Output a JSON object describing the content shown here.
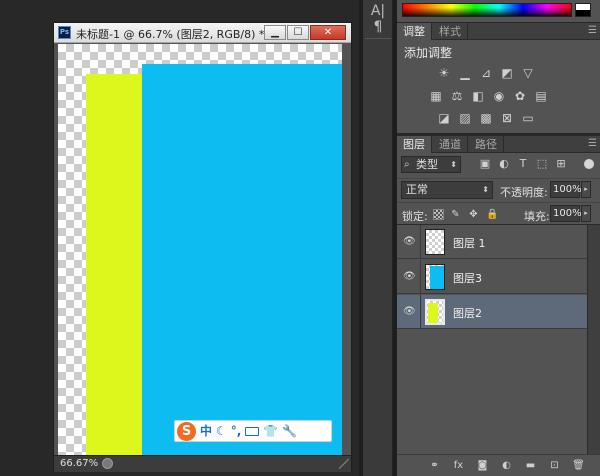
{
  "document": {
    "title": "未标题-1 @ 66.7% (图层2, RGB/8) *",
    "ps_badge": "Ps",
    "zoom": "66.67%",
    "min_glyph": "▁",
    "max_glyph": "☐",
    "close_glyph": "✕"
  },
  "ime_bar": {
    "logo": "S",
    "items": [
      "中",
      "☾",
      "°,",
      "⌨",
      "👕",
      "🔧"
    ]
  },
  "strip": {
    "btn_a": "A|",
    "btn_b": "¶"
  },
  "adjustments": {
    "tabs": [
      "调整",
      "样式"
    ],
    "title": "添加调整"
  },
  "layers": {
    "tabs": [
      "图层",
      "通道",
      "路径"
    ],
    "kind_filter": "类型",
    "blend_mode": "正常",
    "opacity_label": "不透明度:",
    "opacity_value": "100%",
    "lock_label": "锁定:",
    "fill_label": "填充:",
    "fill_value": "100%",
    "items": [
      {
        "name": "图层 1",
        "selected": false
      },
      {
        "name": "图层3",
        "selected": false
      },
      {
        "name": "图层2",
        "selected": true
      }
    ]
  },
  "colors": {
    "yellow_layer": "#dbf71c",
    "blue_layer": "#0dbdf2",
    "selected_row": "#5e6a7a"
  }
}
